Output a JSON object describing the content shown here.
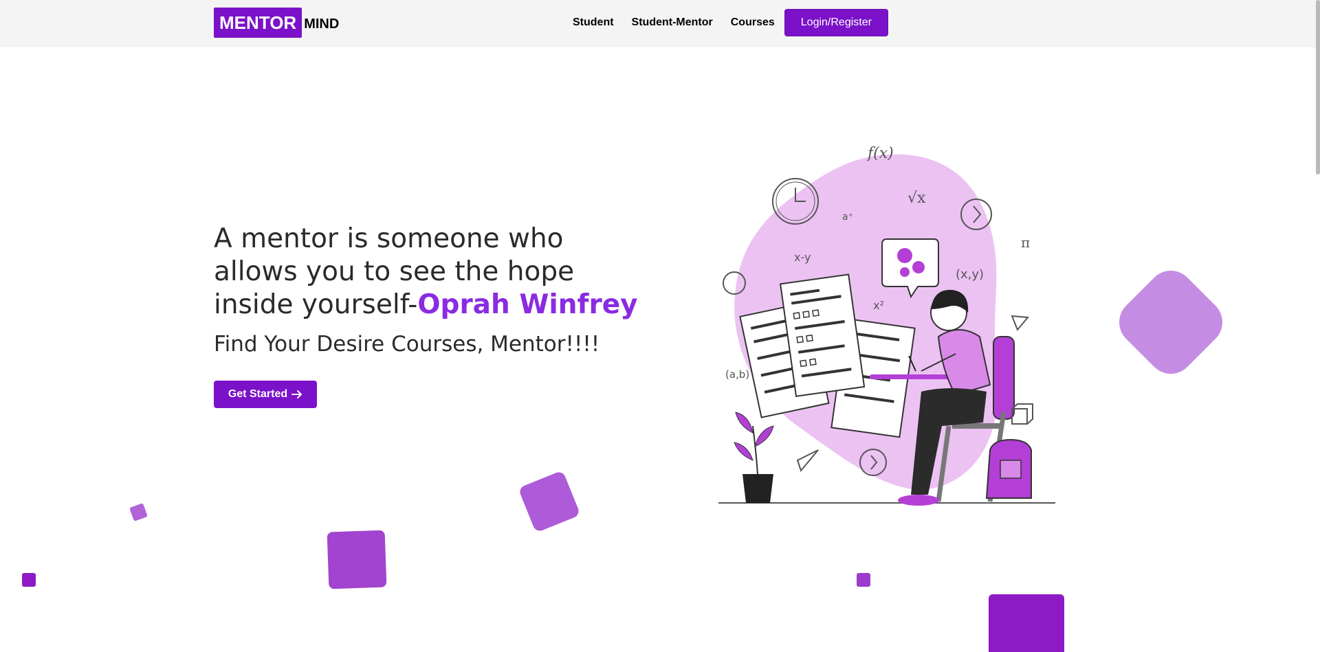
{
  "logo": {
    "boxed": "MENTOR",
    "rest": "MIND"
  },
  "nav": {
    "items": [
      {
        "label": "Student"
      },
      {
        "label": "Student-Mentor"
      },
      {
        "label": "Courses"
      }
    ],
    "login_label": "Login/Register"
  },
  "hero": {
    "quote": "A mentor is someone who allows you to see the hope inside yourself-",
    "author": "Oprah Winfrey",
    "subtitle": "Find Your Desire Courses, Mentor!!!!",
    "cta_label": "Get Started"
  },
  "colors": {
    "brand": "#7b12c9",
    "accent": "#8a2be2",
    "blob": "#ecc2f3"
  },
  "icons": [
    "arrow-right-icon"
  ]
}
